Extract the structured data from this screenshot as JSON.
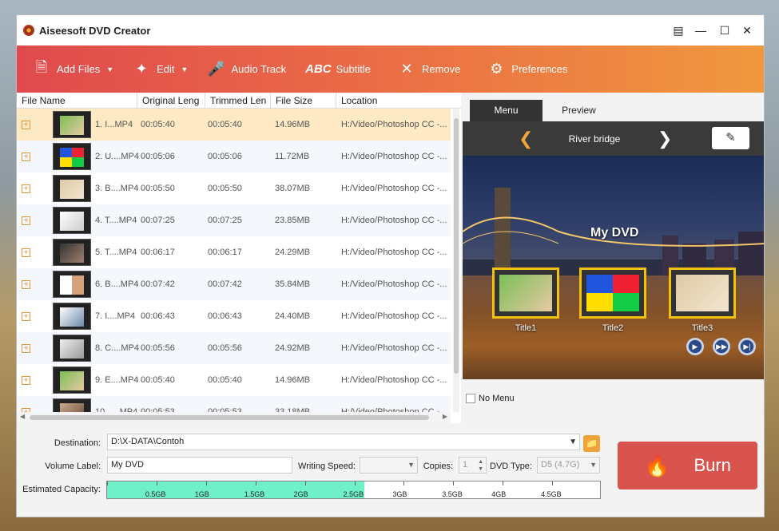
{
  "window": {
    "title": "Aiseesoft DVD Creator"
  },
  "toolbar": {
    "add_files": "Add Files",
    "edit": "Edit",
    "audio_track": "Audio Track",
    "subtitle_prefix": "ABC",
    "subtitle": "Subtitle",
    "remove": "Remove",
    "preferences": "Preferences"
  },
  "table": {
    "headers": [
      "File Name",
      "Original Leng",
      "Trimmed Len",
      "File Size",
      "Location"
    ],
    "rows": [
      {
        "name": "1. I...MP4",
        "orig": "00:05:40",
        "trim": "00:05:40",
        "size": "14.96MB",
        "loc": "H:/Video/Photoshop CC -..."
      },
      {
        "name": "2. U....MP4",
        "orig": "00:05:06",
        "trim": "00:05:06",
        "size": "11.72MB",
        "loc": "H:/Video/Photoshop CC -..."
      },
      {
        "name": "3. B....MP4",
        "orig": "00:05:50",
        "trim": "00:05:50",
        "size": "38.07MB",
        "loc": "H:/Video/Photoshop CC -..."
      },
      {
        "name": "4. T....MP4",
        "orig": "00:07:25",
        "trim": "00:07:25",
        "size": "23.85MB",
        "loc": "H:/Video/Photoshop CC -..."
      },
      {
        "name": "5. T....MP4",
        "orig": "00:06:17",
        "trim": "00:06:17",
        "size": "24.29MB",
        "loc": "H:/Video/Photoshop CC -..."
      },
      {
        "name": "6. B....MP4",
        "orig": "00:07:42",
        "trim": "00:07:42",
        "size": "35.84MB",
        "loc": "H:/Video/Photoshop CC -..."
      },
      {
        "name": "7. I....MP4",
        "orig": "00:06:43",
        "trim": "00:06:43",
        "size": "24.40MB",
        "loc": "H:/Video/Photoshop CC -..."
      },
      {
        "name": "8. C....MP4",
        "orig": "00:05:56",
        "trim": "00:05:56",
        "size": "24.92MB",
        "loc": "H:/Video/Photoshop CC -..."
      },
      {
        "name": "9. E....MP4",
        "orig": "00:05:40",
        "trim": "00:05:40",
        "size": "14.96MB",
        "loc": "H:/Video/Photoshop CC -..."
      },
      {
        "name": "10. ....MP4",
        "orig": "00:05:53",
        "trim": "00:05:53",
        "size": "33.18MB",
        "loc": "H:/Video/Photoshop CC -..."
      }
    ]
  },
  "menu_panel": {
    "tabs": [
      "Menu",
      "Preview"
    ],
    "template_name": "River bridge",
    "dvd_title": "My DVD",
    "titles": [
      "Title1",
      "Title2",
      "Title3"
    ],
    "no_menu": "No Menu"
  },
  "bottom": {
    "destination_label": "Destination:",
    "destination_value": "D:\\X-DATA\\Contoh",
    "volume_label": "Volume Label:",
    "volume_value": "My DVD",
    "writing_speed_label": "Writing Speed:",
    "writing_speed_value": "",
    "copies_label": "Copies:",
    "copies_value": "1",
    "dvd_type_label": "DVD Type:",
    "dvd_type_value": "D5 (4.7G)",
    "capacity_label": "Estimated Capacity:",
    "capacity_ticks": [
      "0.5GB",
      "1GB",
      "1.5GB",
      "2GB",
      "2.5GB",
      "3GB",
      "3.5GB",
      "4GB",
      "4.5GB"
    ],
    "capacity_used_gb": 2.6,
    "capacity_max_gb": 5,
    "burn_label": "Burn"
  },
  "colors": {
    "toolbar_start": "#e04a4e",
    "toolbar_end": "#f0983e",
    "burn": "#d9534f",
    "capacity_fill": "#6ff0c8"
  }
}
